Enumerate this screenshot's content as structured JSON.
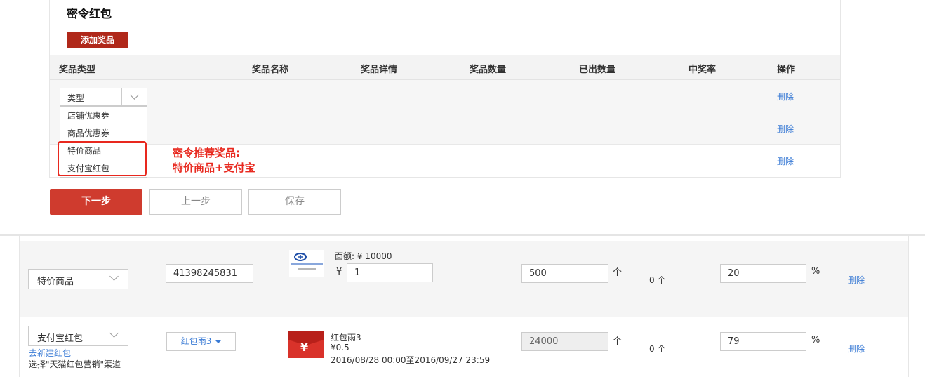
{
  "section": {
    "title": "密令红包",
    "add_button": "添加奖品"
  },
  "table": {
    "headers": [
      "奖品类型",
      "奖品名称",
      "奖品详情",
      "奖品数量",
      "已出数量",
      "中奖率",
      "操作"
    ],
    "delete_label": "删除"
  },
  "type_select": {
    "placeholder": "类型",
    "options": [
      "店铺优惠券",
      "商品优惠券",
      "特价商品",
      "支付宝红包"
    ]
  },
  "annotation": {
    "line1": "密令推荐奖品:",
    "line2": "特价商品+支付宝"
  },
  "actions": {
    "next": "下一步",
    "prev": "上一步",
    "save": "保存"
  },
  "rows": [
    {
      "type": "特价商品",
      "item_id": "41398245831",
      "face_value": "面额: ¥ 10000",
      "currency": "¥",
      "price": "1",
      "quantity": "500",
      "quantity_unit": "个",
      "issued": "0 个",
      "rate": "20",
      "rate_unit": "%",
      "delete": "删除"
    },
    {
      "type": "支付宝红包",
      "create_link": "去新建红包",
      "channel_hint": "选择\"天猫红包营销\"渠道",
      "packet_select": "红包雨3",
      "packet_name": "红包雨3",
      "packet_value": "¥0.5",
      "packet_period": "2016/08/28 00:00至2016/09/27 23:59",
      "packet_icon_glyph": "¥",
      "quantity": "24000",
      "quantity_unit": "个",
      "issued": "0 个",
      "rate": "79",
      "rate_unit": "%",
      "delete": "删除"
    }
  ],
  "colors": {
    "primary_red": "#cf3b2e",
    "accent_red": "#e8281e",
    "link_blue": "#3a7bd5"
  }
}
